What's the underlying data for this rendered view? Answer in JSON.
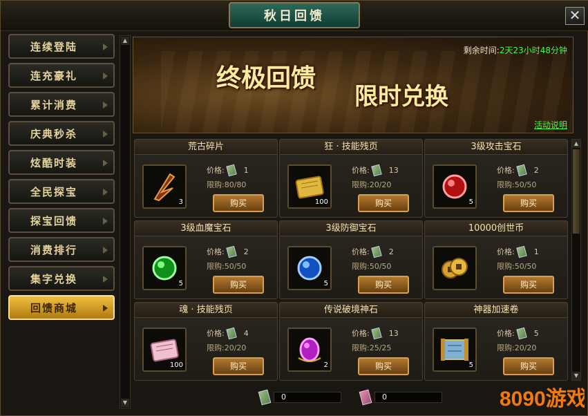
{
  "window": {
    "title": "秋日回馈",
    "close_label": "✕"
  },
  "sidebar": {
    "items": [
      {
        "label": "连续登陆",
        "active": false
      },
      {
        "label": "连充豪礼",
        "active": false
      },
      {
        "label": "累计消费",
        "active": false
      },
      {
        "label": "庆典秒杀",
        "active": false
      },
      {
        "label": "炫酷时装",
        "active": false
      },
      {
        "label": "全民探宝",
        "active": false
      },
      {
        "label": "探宝回馈",
        "active": false
      },
      {
        "label": "消费排行",
        "active": false
      },
      {
        "label": "集字兑换",
        "active": false
      },
      {
        "label": "回馈商城",
        "active": true
      }
    ]
  },
  "banner": {
    "title1": "终极回馈",
    "title2": "限时兑换",
    "time_label": "剩余时间:",
    "time_value": "2天23小时48分钟",
    "event_link": "活动说明"
  },
  "shop": {
    "price_label": "价格:",
    "limit_label": "限购:",
    "buy_label": "购买",
    "items": [
      {
        "name": "荒古碎片",
        "price": "1",
        "limit": "80/80",
        "count": "3",
        "icon": "blade-shard-icon"
      },
      {
        "name": "狂 · 技能残页",
        "price": "13",
        "limit": "20/20",
        "count": "100",
        "icon": "gold-scroll-icon"
      },
      {
        "name": "3级攻击宝石",
        "price": "2",
        "limit": "50/50",
        "count": "5",
        "icon": "red-gem-icon"
      },
      {
        "name": "3级血魔宝石",
        "price": "2",
        "limit": "50/50",
        "count": "5",
        "icon": "green-gem-icon"
      },
      {
        "name": "3级防御宝石",
        "price": "2",
        "limit": "50/50",
        "count": "5",
        "icon": "blue-gem-icon"
      },
      {
        "name": "10000创世币",
        "price": "1",
        "limit": "50/50",
        "count": "",
        "icon": "coin-icon"
      },
      {
        "name": "魂 · 技能残页",
        "price": "4",
        "limit": "20/20",
        "count": "100",
        "icon": "pink-scroll-icon"
      },
      {
        "name": "传说破境神石",
        "price": "13",
        "limit": "25/25",
        "count": "2",
        "icon": "purple-stone-icon"
      },
      {
        "name": "神器加速卷",
        "price": "5",
        "limit": "20/20",
        "count": "5",
        "icon": "blue-scroll-icon"
      }
    ]
  },
  "footer": {
    "currency1": "0",
    "currency2": "0"
  },
  "watermark": {
    "text": "8090游戏"
  }
}
